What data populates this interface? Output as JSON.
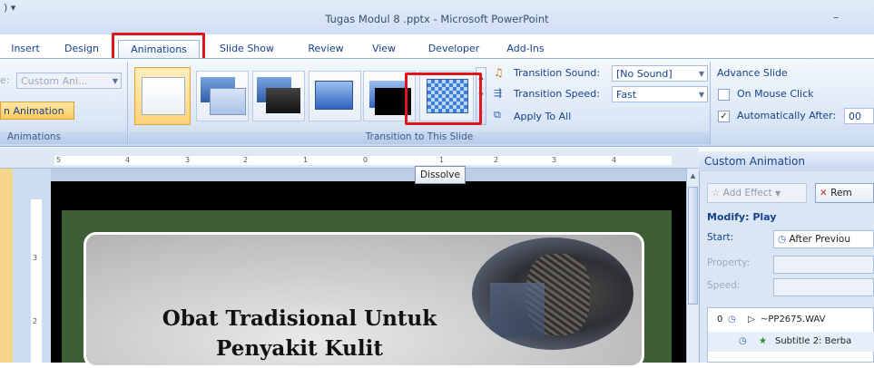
{
  "window": {
    "title": "Tugas Modul 8 .pptx - Microsoft PowerPoint",
    "qat_glyph": ") ▾",
    "minimize_glyph": "–"
  },
  "tabs": [
    "Insert",
    "Design",
    "Animations",
    "Slide Show",
    "Review",
    "View",
    "Developer",
    "Add-Ins"
  ],
  "active_tab": "Animations",
  "ribbon": {
    "animations_group": {
      "animate_label": "e:",
      "animate_value": "Custom Ani...",
      "custom_animation_button": "n Animation",
      "group_label": "Animations"
    },
    "transition_group": {
      "group_label": "Transition to This Slide",
      "selected_transition": "Dissolve",
      "sound_label": "Transition Sound:",
      "sound_value": "[No Sound]",
      "speed_label": "Transition Speed:",
      "speed_value": "Fast",
      "apply_all": "Apply To All"
    },
    "advance_group": {
      "title": "Advance Slide",
      "on_mouse_click": "On Mouse Click",
      "on_mouse_click_checked": false,
      "auto_after": "Automatically After:",
      "auto_after_checked": true,
      "auto_after_value": "00"
    }
  },
  "ruler": {
    "labels": [
      "5",
      "4",
      "3",
      "2",
      "1",
      "0",
      "1",
      "2",
      "3",
      "4"
    ],
    "vertical_labels": [
      "3",
      "2"
    ]
  },
  "tooltip": "Dissolve",
  "slide": {
    "title_line1": "Obat Tradisional Untuk",
    "title_line2": "Penyakit Kulit"
  },
  "custom_animation_pane": {
    "title": "Custom Animation",
    "add_effect": "Add Effect",
    "remove": "Rem",
    "modify": "Modify: Play",
    "start_label": "Start:",
    "start_value": "After Previou",
    "property_label": "Property:",
    "speed_label": "Speed:",
    "items": [
      {
        "order": "0",
        "name": "~PP2675.WAV"
      },
      {
        "order": "",
        "name": "Subtitle 2: Berba"
      }
    ]
  },
  "colors": {
    "highlight_red": "#e0141b",
    "ribbon_blue": "#dbe7f6",
    "slide_green": "#3d5e34"
  }
}
